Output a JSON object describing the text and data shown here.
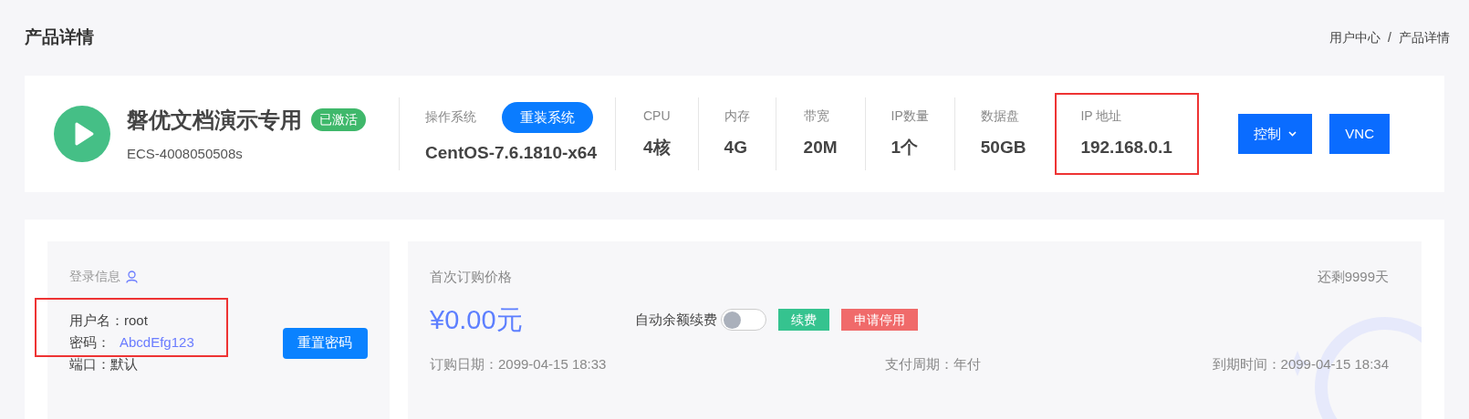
{
  "page_title": "产品详情",
  "breadcrumb": [
    "用户中心",
    "/",
    "产品详情"
  ],
  "product": {
    "name": "磐优文档演示专用",
    "status": "已激活",
    "id": "ECS-4008050508s"
  },
  "os": {
    "label": "操作系统",
    "button": "重装系统",
    "value": "CentOS-7.6.1810-x64"
  },
  "specs": [
    {
      "label": "CPU",
      "value": "4核",
      "highlighted": false
    },
    {
      "label": "内存",
      "value": "4G",
      "highlighted": false
    },
    {
      "label": "带宽",
      "value": "20M",
      "highlighted": false
    },
    {
      "label": "IP数量",
      "value": "1个",
      "highlighted": false
    },
    {
      "label": "数据盘",
      "value": "50GB",
      "highlighted": false
    },
    {
      "label": "IP 地址",
      "value": "192.168.0.1",
      "highlighted": true
    }
  ],
  "actions": [
    {
      "label": "控制",
      "kind": "dropdown"
    },
    {
      "label": "VNC",
      "kind": "button"
    }
  ],
  "login": {
    "title": "登录信息",
    "highlighted": true,
    "fields": [
      {
        "label": "用户名：",
        "value": "root",
        "kind": "plain"
      },
      {
        "label": "密码：",
        "value": "AbcdEfg123",
        "kind": "secret"
      },
      {
        "label": "端口：",
        "value": "默认",
        "kind": "plain"
      }
    ],
    "button": "重置密码"
  },
  "billing": {
    "title": "首次订购价格",
    "remaining": "还剩9999天",
    "price": "¥0.00元",
    "auto_renew": {
      "label": "自动余额续费",
      "on": false
    },
    "buttons": [
      {
        "label": "续费",
        "color": "#35c38f"
      },
      {
        "label": "申请停用",
        "color": "#f06a6a"
      }
    ],
    "info": [
      {
        "label": "订购日期：",
        "value": "2099-04-15 18:33"
      },
      {
        "label": "支付周期：",
        "value": "年付"
      },
      {
        "label": "到期时间：",
        "value": "2099-04-15 18:34"
      }
    ]
  }
}
